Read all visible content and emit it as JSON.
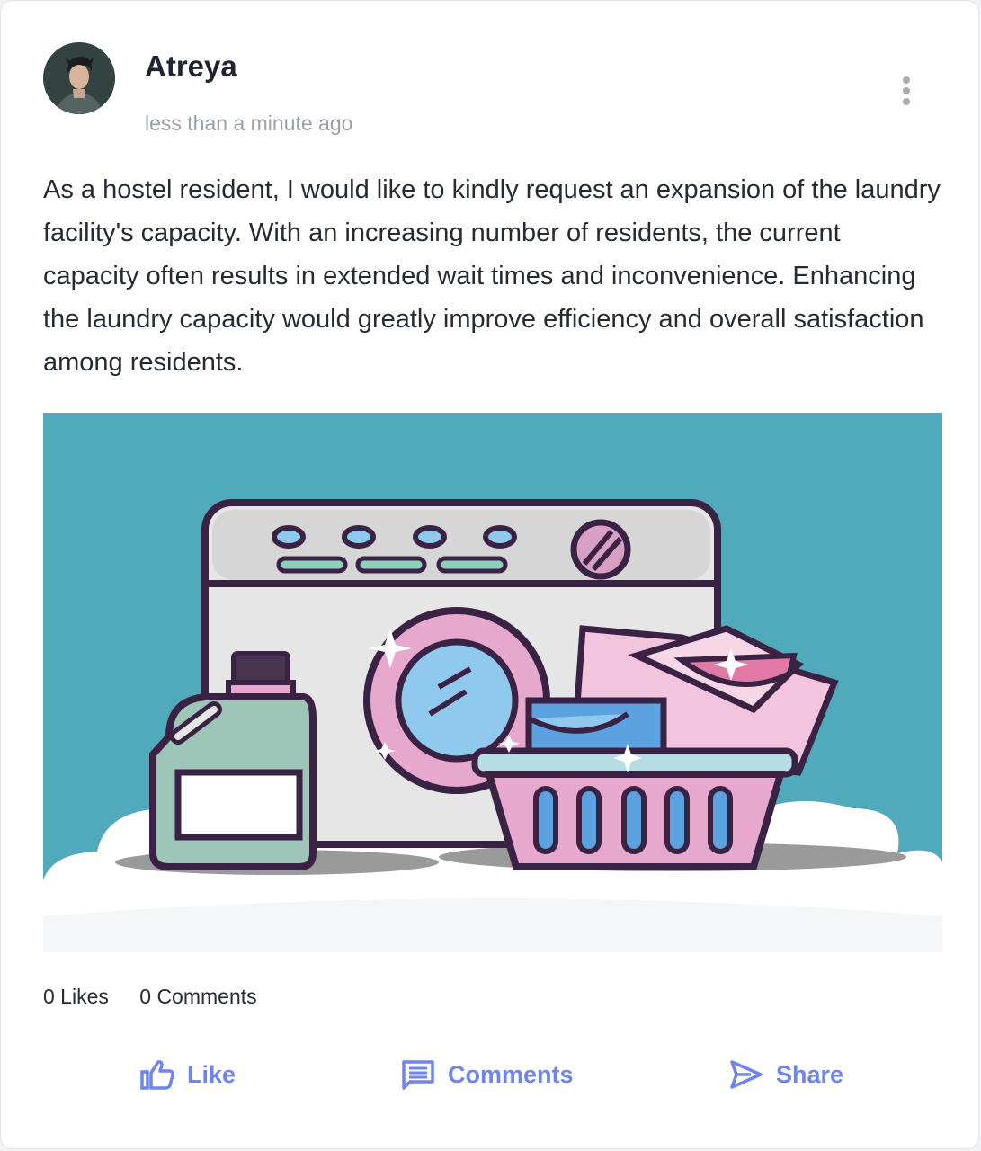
{
  "post": {
    "author": "Atreya",
    "timestamp": "less than a minute ago",
    "body": "As a hostel resident, I would like to kindly request an expansion of the laundry facility's capacity. With an increasing number of residents, the current capacity often results in extended wait times and inconvenience. Enhancing the laundry capacity would greatly improve efficiency and overall satisfaction among residents.",
    "image_subject": "washing-machine-laundry-illustration"
  },
  "stats": {
    "likes": "0 Likes",
    "comments": "0 Comments"
  },
  "actions": {
    "like": "Like",
    "comments": "Comments",
    "share": "Share"
  },
  "icons": {
    "menu": "more-vertical-icon",
    "like": "thumbs-up-icon",
    "comments": "comment-icon",
    "share": "send-icon"
  },
  "colors": {
    "accent": "#6f84ef",
    "image_background": "#51aabb"
  }
}
